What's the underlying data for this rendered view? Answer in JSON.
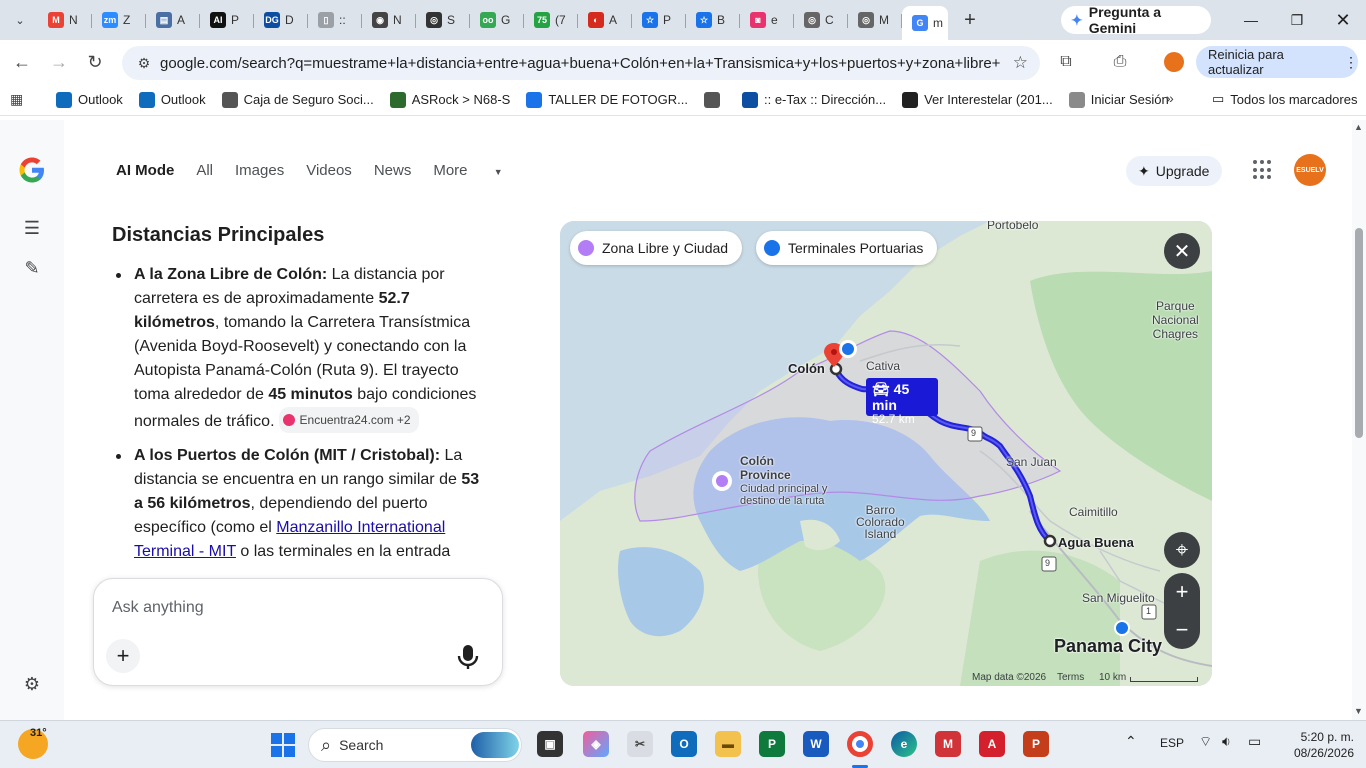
{
  "tabs": [
    {
      "label": "N",
      "color": "#ea4335",
      "letter": "M"
    },
    {
      "label": "Z",
      "color": "#2d8cff",
      "letter": "zm"
    },
    {
      "label": "A",
      "color": "#4a6fa5",
      "letter": "▤"
    },
    {
      "label": "P",
      "color": "#111111",
      "letter": "AI"
    },
    {
      "label": "D",
      "color": "#0b4ea2",
      "letter": "DG"
    },
    {
      "label": "::",
      "color": "#9aa0a6",
      "letter": "▯"
    },
    {
      "label": "N",
      "color": "#444444",
      "letter": "◉"
    },
    {
      "label": "S",
      "color": "#333333",
      "letter": "◎"
    },
    {
      "label": "G",
      "color": "#34a853",
      "letter": "oo"
    },
    {
      "label": "(7",
      "color": "#25a244",
      "letter": "75"
    },
    {
      "label": "A",
      "color": "#d52b1e",
      "letter": "◐"
    },
    {
      "label": "P",
      "color": "#1a73e8",
      "letter": "☆"
    },
    {
      "label": "B",
      "color": "#1a73e8",
      "letter": "☆"
    },
    {
      "label": "e",
      "color": "#e8336f",
      "letter": "◙"
    },
    {
      "label": "C",
      "color": "#666666",
      "letter": "◎"
    },
    {
      "label": "M",
      "color": "#666666",
      "letter": "◎"
    },
    {
      "label": "m",
      "color": "#4285f4",
      "letter": "G",
      "active": true
    }
  ],
  "gemini_button": "Pregunta a Gemini",
  "address": {
    "url": "google.com/search?q=muestrame+la+distancia+entre+agua+buena+Colón+en+la+Transismica+y+los+puertos+y+zona+libre+de+..."
  },
  "restart_button": "Reinicia para actualizar",
  "bookmarks": [
    {
      "label": "Outlook",
      "color": "#0f6cbd"
    },
    {
      "label": "Outlook",
      "color": "#0f6cbd"
    },
    {
      "label": "Caja de Seguro Soci...",
      "color": "#555555"
    },
    {
      "label": "ASRock > N68-S",
      "color": "#2d6a2d"
    },
    {
      "label": "TALLER DE FOTOGR...",
      "color": "#1a73e8"
    },
    {
      "label": "",
      "color": "#555555"
    },
    {
      "label": ":: e-Tax :: Dirección...",
      "color": "#0b4ea2"
    },
    {
      "label": "Ver Interestelar (201...",
      "color": "#222222"
    },
    {
      "label": "Iniciar Sesión",
      "color": "#8a8a8a"
    }
  ],
  "all_bookmarks": "Todos los marcadores",
  "search_tabs": [
    "AI Mode",
    "All",
    "Images",
    "Videos",
    "News",
    "More"
  ],
  "upgrade_label": "Upgrade",
  "avatar_text": "ESUELV",
  "answer": {
    "heading": "Distancias Principales",
    "item1": {
      "lead": "A la Zona Libre de Colón:",
      "t1": " La distancia por carretera es de aproximadamente ",
      "b1": "52.7 kilómetros",
      "t2": ", tomando la Carretera Transístmica (Avenida Boyd-Roosevelt) y conectando con la Autopista Panamá-Colón (Ruta 9). El trayecto toma alrededor de ",
      "b2": "45 minutos",
      "t3": " bajo condiciones normales de tráfico.",
      "cite": "Encuentra24.com +2"
    },
    "item2": {
      "lead": "A los Puertos de Colón (MIT / Cristobal):",
      "t1": " La distancia se encuentra en un rango similar de ",
      "b1": "53 a 56 kilómetros",
      "t2": ", dependiendo del puerto específico (como el ",
      "link": "Manzanillo International Terminal - MIT",
      "t3": " o las terminales en la entrada"
    }
  },
  "ask": {
    "placeholder": "Ask anything"
  },
  "map": {
    "chips": [
      {
        "label": "Zona Libre y Ciudad",
        "color": "#b37df5"
      },
      {
        "label": "Terminales Portuarias",
        "color": "#1a73e8"
      }
    ],
    "route_time": "45 min",
    "route_distance": "52.7 km",
    "labels": {
      "portobelo": "Portobelo",
      "parque": "Parque\nNacional\nChagres",
      "colon": "Colón",
      "cativa": "Cativa",
      "province": "Colón\nProvince",
      "province_sub": "Ciudad principal y\ndestino de la ruta",
      "barro": "Barro\nColorado\nIsland",
      "sanjuan": "San Juan",
      "caimitillo": "Caimitillo",
      "aguabuena": "Agua Buena",
      "sanmiguelito": "San Miguelito",
      "panama": "Panama City",
      "route9a": "9",
      "route9b": "9",
      "route1": "1"
    },
    "footer": {
      "mapdata": "Map data ©2026",
      "terms": "Terms",
      "scale": "10 km"
    }
  },
  "taskbar": {
    "temp": "31°",
    "search": "Search",
    "lang": "ESP",
    "time": "5:20 p. m.",
    "date": "08/26/2026"
  }
}
